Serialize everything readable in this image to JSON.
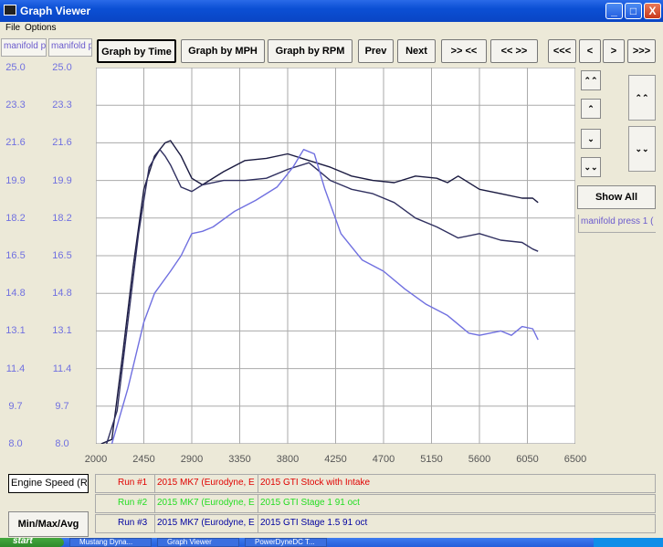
{
  "window": {
    "title": "Graph Viewer",
    "btn_min": "_",
    "btn_max": "□",
    "btn_close": "X"
  },
  "menu": {
    "file": "File",
    "options": "Options"
  },
  "header_tabs": [
    "manifold p",
    "manifold p"
  ],
  "toolbar": {
    "graph_time": "Graph by Time",
    "graph_mph": "Graph by MPH",
    "graph_rpm": "Graph by RPM",
    "prev": "Prev",
    "next": "Next",
    "zoom_in": ">> <<",
    "zoom_out": "<< >>",
    "first": "<<<",
    "back": "<",
    "forward": ">",
    "last": ">>>"
  },
  "side": {
    "up_fast": "⌃⌃",
    "up": "⌃",
    "down": "⌄",
    "down_fast": "⌄⌄",
    "tall_up": "⌃⌃",
    "tall_down": "⌄⌄",
    "show_all": "Show All",
    "legend_field": "manifold press 1 ("
  },
  "bottom": {
    "xaxis_label": "Engine Speed (RPI",
    "minmax": "Min/Max/Avg",
    "runs": [
      {
        "label": "Run #1",
        "car": "2015 MK7 (Eurodyne, E",
        "desc": "2015 GTI Stock with Intake",
        "color": "#e00000"
      },
      {
        "label": "Run #2",
        "car": "2015 MK7 (Eurodyne, E",
        "desc": "2015 GTI Stage 1 91 oct",
        "color": "#22dd22"
      },
      {
        "label": "Run #3",
        "car": "2015 MK7 (Eurodyne, E",
        "desc": "2015 GTI Stage 1.5 91 oct",
        "color": "#0000a0"
      }
    ]
  },
  "taskbar": {
    "start": "start",
    "tasks": [
      "Mustang Dyna...",
      "Graph Viewer",
      "PowerDyneDC T..."
    ]
  },
  "chart_data": {
    "type": "line",
    "ylim": [
      8.0,
      25.0
    ],
    "xlim": [
      2000,
      6500
    ],
    "yticks": [
      "25.0",
      "23.3",
      "21.6",
      "19.9",
      "18.2",
      "16.5",
      "14.8",
      "13.1",
      "11.4",
      "9.7",
      "8.0"
    ],
    "xticks": [
      "2000",
      "2450",
      "2900",
      "3350",
      "3800",
      "4250",
      "4700",
      "5150",
      "5600",
      "6050",
      "6500"
    ],
    "series": [
      {
        "color": "#1a1a40",
        "x": [
          2050,
          2150,
          2250,
          2350,
          2450,
          2550,
          2650,
          2700,
          2800,
          2900,
          3000,
          3200,
          3400,
          3600,
          3800,
          4000,
          4200,
          4400,
          4600,
          4800,
          5000,
          5200,
          5300,
          5400,
          5600,
          5800,
          6000,
          6100,
          6150
        ],
        "values": [
          8.0,
          8.2,
          12.0,
          16.0,
          19.5,
          21.0,
          21.6,
          21.7,
          21.0,
          20.0,
          19.7,
          20.3,
          20.8,
          20.9,
          21.1,
          20.8,
          20.5,
          20.1,
          19.9,
          19.8,
          20.1,
          20.0,
          19.8,
          20.1,
          19.5,
          19.3,
          19.1,
          19.1,
          18.9
        ]
      },
      {
        "color": "#303060",
        "x": [
          2100,
          2200,
          2300,
          2400,
          2500,
          2600,
          2650,
          2700,
          2800,
          2900,
          3000,
          3200,
          3400,
          3600,
          3800,
          4000,
          4200,
          4400,
          4600,
          4800,
          5000,
          5200,
          5400,
          5600,
          5800,
          6000,
          6100,
          6150
        ],
        "values": [
          8.0,
          9.5,
          13.5,
          17.5,
          20.5,
          21.3,
          21.0,
          20.6,
          19.6,
          19.4,
          19.7,
          19.9,
          19.9,
          20.0,
          20.4,
          20.7,
          19.9,
          19.5,
          19.3,
          18.9,
          18.2,
          17.8,
          17.3,
          17.5,
          17.2,
          17.1,
          16.8,
          16.7
        ]
      },
      {
        "color": "#7070e0",
        "x": [
          2150,
          2300,
          2450,
          2550,
          2700,
          2800,
          2900,
          3000,
          3100,
          3300,
          3500,
          3700,
          3850,
          3950,
          4050,
          4150,
          4300,
          4500,
          4700,
          4900,
          5100,
          5300,
          5500,
          5600,
          5800,
          5900,
          6000,
          6100,
          6150
        ],
        "values": [
          8.0,
          10.5,
          13.5,
          14.8,
          15.8,
          16.5,
          17.5,
          17.6,
          17.8,
          18.5,
          19.0,
          19.6,
          20.5,
          21.3,
          21.1,
          19.5,
          17.5,
          16.3,
          15.8,
          15.0,
          14.3,
          13.8,
          13.0,
          12.9,
          13.1,
          12.9,
          13.3,
          13.2,
          12.7
        ]
      }
    ]
  }
}
